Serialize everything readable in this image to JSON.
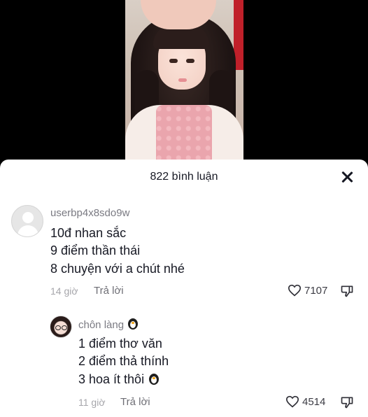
{
  "header": {
    "title": "822 bình luận",
    "close_icon": "close-icon"
  },
  "comment": {
    "username": "userbp4x8sdo9w",
    "lines": [
      "10đ nhan sắc",
      "9 điểm thần thái",
      "8 chuyện với a chút nhé"
    ],
    "time": "14 giờ",
    "reply_label": "Trả lời",
    "likes": "7107"
  },
  "reply": {
    "username": "chôn làng",
    "lines": [
      "1 điểm thơ văn",
      "2 điểm thả thính",
      "3 hoa ít thôi"
    ],
    "time": "11 giờ",
    "reply_label": "Trả lời",
    "likes": "4514"
  }
}
